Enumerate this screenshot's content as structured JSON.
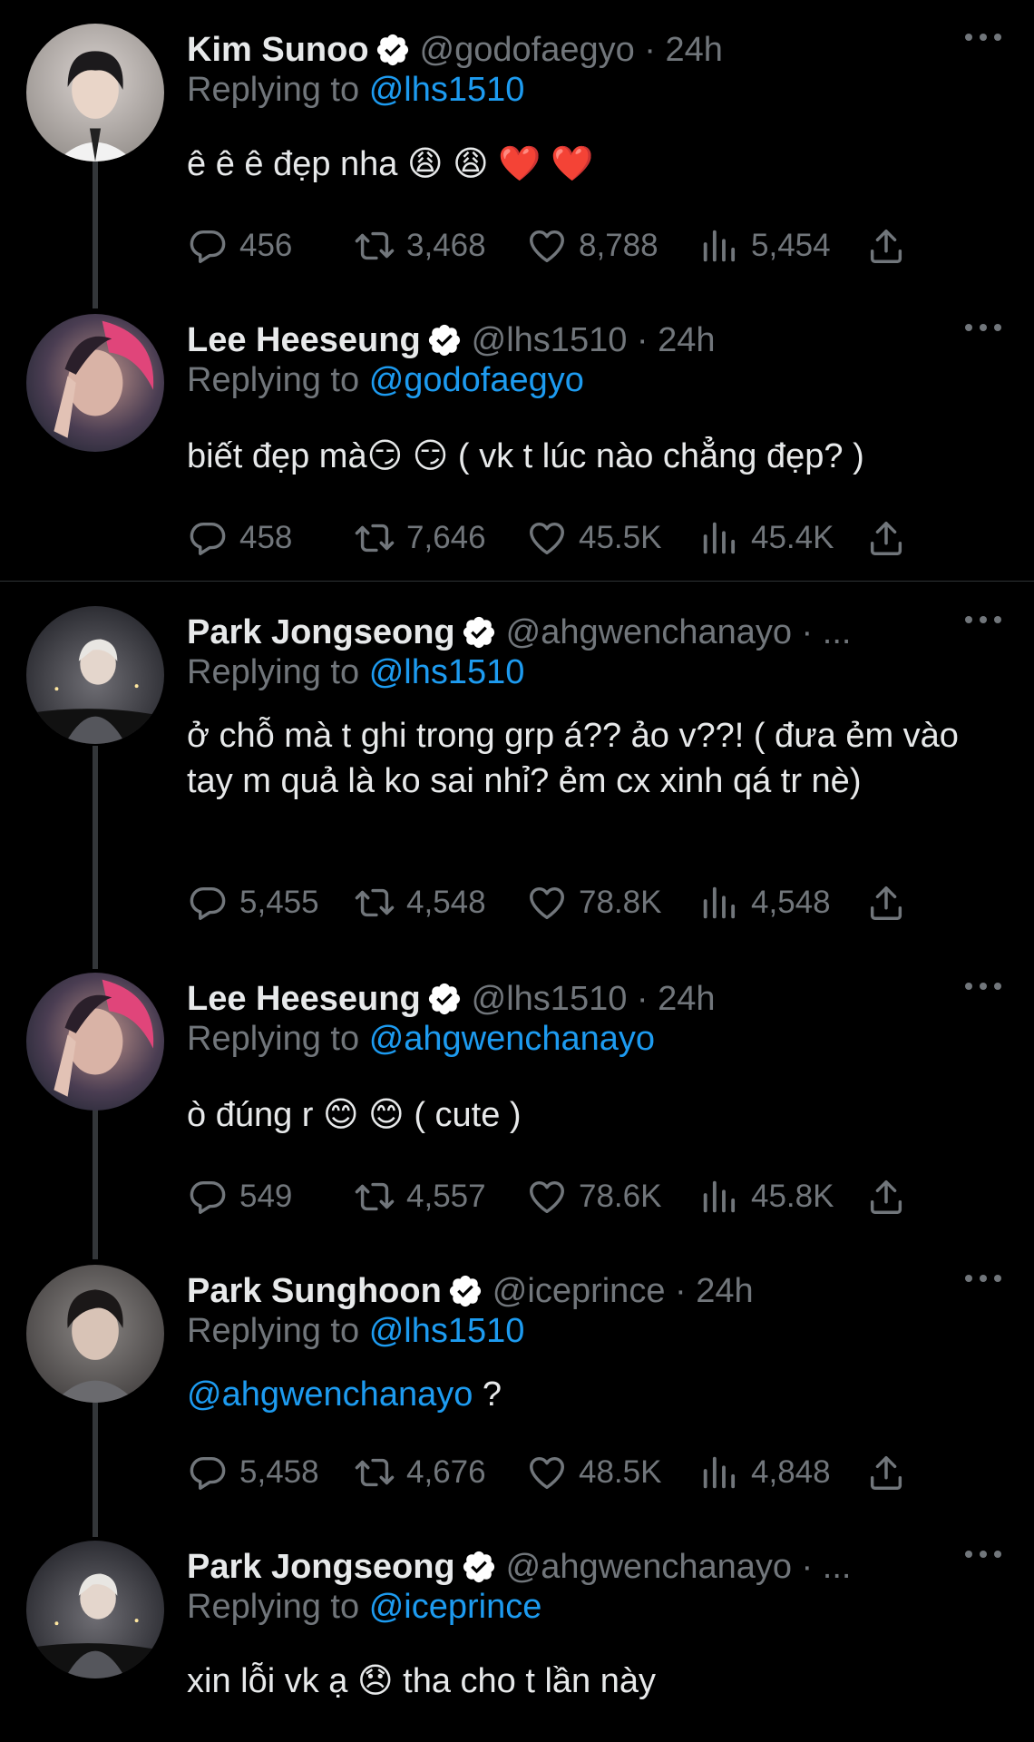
{
  "ui": {
    "replying_prefix": "Replying to",
    "more_label": "More"
  },
  "tweets": [
    {
      "name": "Kim Sunoo",
      "handle": "@godofaegyo · 24h",
      "reply_to": "@lhs1510",
      "text": "ê ê ê đẹp nha 😩 😩  ❤️ ❤️",
      "stats": {
        "replies": "456",
        "retweets": "3,468",
        "likes": "8,788",
        "views": "5,454"
      }
    },
    {
      "name": "Lee Heeseung",
      "handle": "@lhs1510 · 24h",
      "reply_to": "@godofaegyo",
      "text": "biết đẹp mà😏 😏  ( vk t lúc nào chẳng đẹp? )",
      "stats": {
        "replies": "458",
        "retweets": "7,646",
        "likes": "45.5K",
        "views": "45.4K"
      }
    },
    {
      "name": "Park Jongseong",
      "handle": "@ahgwenchanayo · ...",
      "reply_to": "@lhs1510",
      "text": "ở chỗ mà t ghi trong grp á?? ảo v??! ( đưa ẻm vào tay m quả là ko sai nhỉ? ẻm cx xinh qá tr nè)",
      "stats": {
        "replies": "5,455",
        "retweets": "4,548",
        "likes": "78.8K",
        "views": "4,548"
      }
    },
    {
      "name": "Lee Heeseung",
      "handle": "@lhs1510 · 24h",
      "reply_to": "@ahgwenchanayo",
      "text": "ò đúng r 😊 😊  ( cute )",
      "stats": {
        "replies": "549",
        "retweets": "4,557",
        "likes": "78.6K",
        "views": "45.8K"
      }
    },
    {
      "name": "Park Sunghoon",
      "handle": "@iceprince · 24h",
      "reply_to": "@lhs1510",
      "mention": "@ahgwenchanayo",
      "text": " ?",
      "stats": {
        "replies": "5,458",
        "retweets": "4,676",
        "likes": "48.5K",
        "views": "4,848"
      }
    },
    {
      "name": "Park Jongseong",
      "handle": "@ahgwenchanayo · ...",
      "reply_to": "@iceprince",
      "text": "xin lỗi vk ạ 😞  tha cho t lần này"
    }
  ],
  "colors": {
    "background": "#000000",
    "text": "#e7e9ea",
    "muted": "#71767b",
    "link": "#1d9bf0",
    "verified": "#ffffff"
  },
  "icons": [
    "verified-badge-icon",
    "more-dots-icon",
    "reply-icon",
    "retweet-icon",
    "like-icon",
    "views-icon",
    "share-icon"
  ]
}
